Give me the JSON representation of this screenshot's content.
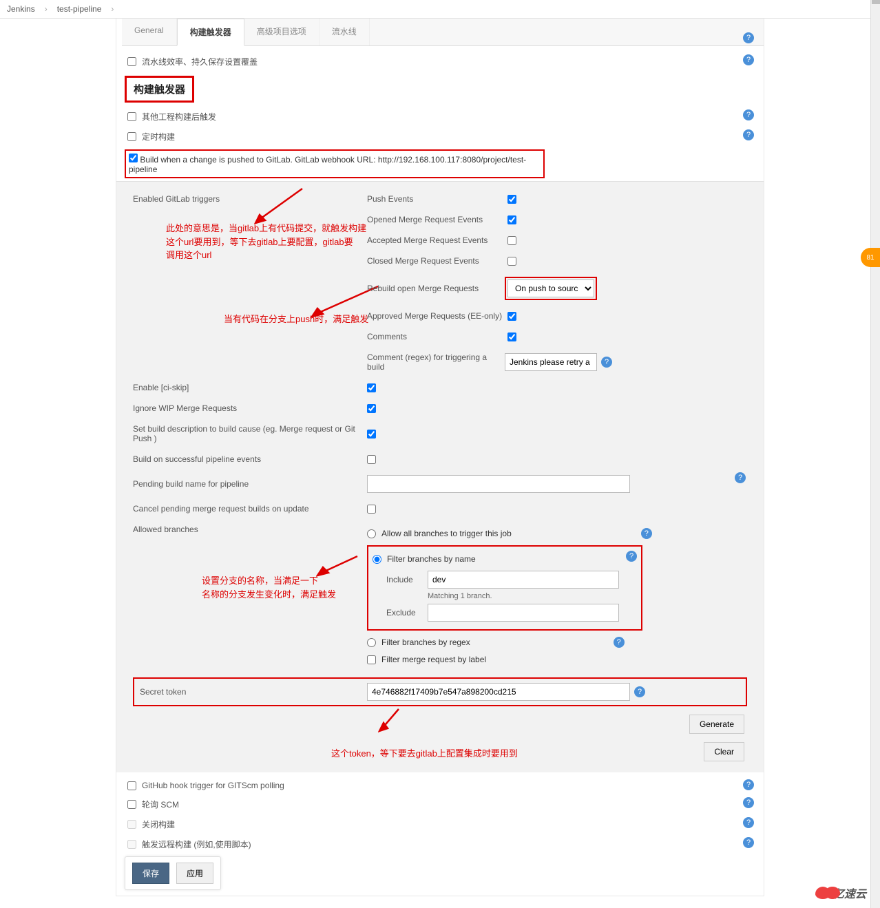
{
  "breadcrumb": {
    "jenkins": "Jenkins",
    "pipeline": "test-pipeline"
  },
  "tabs": {
    "general": "General",
    "triggers": "构建触发器",
    "advanced": "高级项目选项",
    "pipeline": "流水线"
  },
  "topRow": {
    "efficiency": "流水线效率、持久保存设置覆盖"
  },
  "sectionTitle": "构建触发器",
  "triggers": {
    "afterOther": "其他工程构建后触发",
    "timed": "定时构建",
    "gitlab": "Build when a change is pushed to GitLab. GitLab webhook URL: http://192.168.100.117:8080/project/test-pipeline"
  },
  "gitlab": {
    "enabledLabel": "Enabled GitLab triggers",
    "pushEvents": "Push Events",
    "openedMR": "Opened Merge Request Events",
    "acceptedMR": "Accepted Merge Request Events",
    "closedMR": "Closed Merge Request Events",
    "rebuildMR": "Rebuild open Merge Requests",
    "rebuildSelect": "On push to source bra",
    "approvedMR": "Approved Merge Requests (EE-only)",
    "comments": "Comments",
    "commentRegex": "Comment (regex) for triggering a build",
    "commentValue": "Jenkins please retry a buil",
    "enableCiSkip": "Enable [ci-skip]",
    "ignoreWIP": "Ignore WIP Merge Requests",
    "setDescription": "Set build description to build cause (eg. Merge request or Git Push )",
    "buildOnSuccess": "Build on successful pipeline events",
    "pendingName": "Pending build name for pipeline",
    "cancelPending": "Cancel pending merge request builds on update",
    "allowedBranches": "Allowed branches",
    "allowAll": "Allow all branches to trigger this job",
    "filterByName": "Filter branches by name",
    "include": "Include",
    "includeValue": "dev",
    "matching": "Matching 1 branch.",
    "exclude": "Exclude",
    "filterByRegex": "Filter branches by regex",
    "filterByLabel": "Filter merge request by label",
    "secretToken": "Secret token",
    "tokenValue": "4e746882f17409b7e547a898200cd215",
    "generate": "Generate",
    "clear": "Clear"
  },
  "bottom": {
    "githubHook": "GitHub hook trigger for GITScm polling",
    "pollSCM": "轮询 SCM",
    "closeBuild": "关闭构建",
    "remoteTrigger": "触发远程构建 (例如,使用脚本)"
  },
  "annotations": {
    "a1": "此处的意思是，当gitlab上有代码提交，就触发构建\n这个url要用到，等下去gitlab上要配置，gitlab要\n调用这个url",
    "a2": "当有代码在分支上push时，满足触发",
    "a3": "设置分支的名称，当满足一下\n名称的分支发生变化时，满足触发",
    "a4": "这个token，等下要去gitlab上配置集成时要用到"
  },
  "buttons": {
    "save": "保存",
    "apply": "应用"
  },
  "watermark": "亿速云",
  "helpGlyph": "?",
  "badge": "81"
}
